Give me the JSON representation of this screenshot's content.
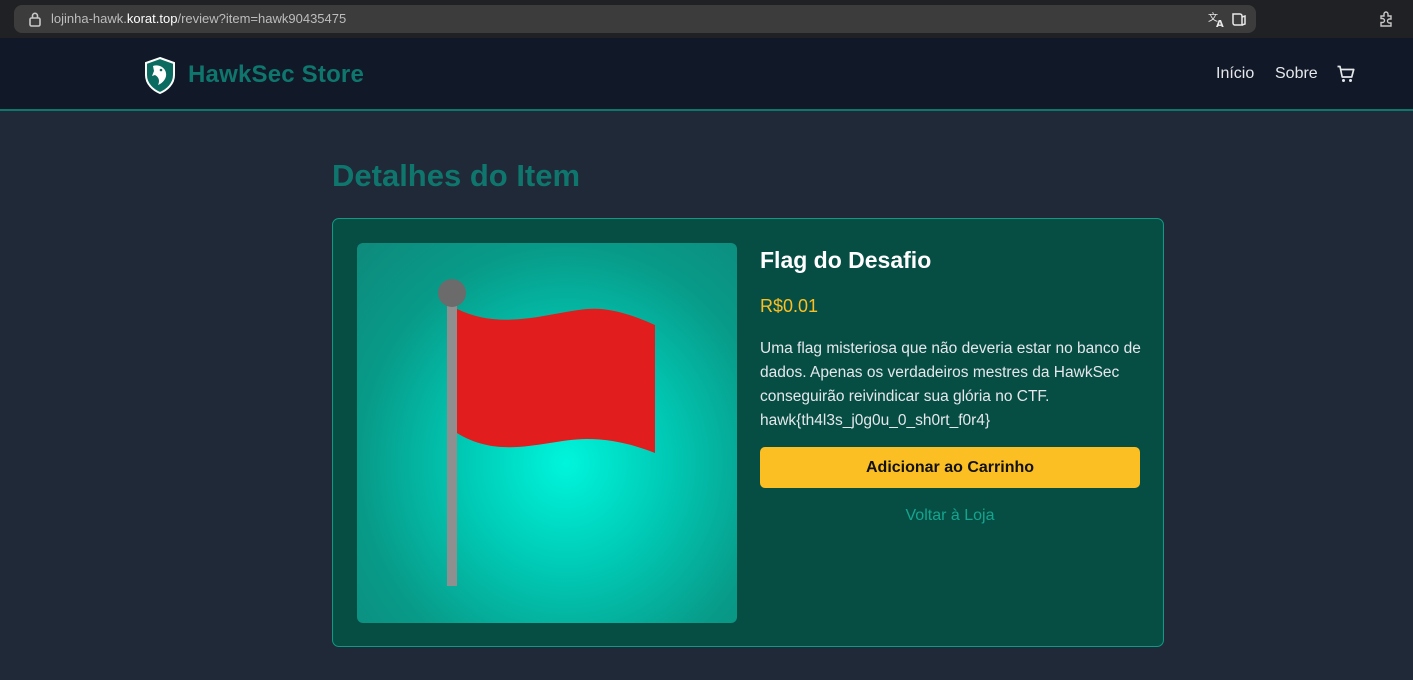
{
  "browser": {
    "url_prefix": "lojinha-hawk.",
    "url_host": "korat.top",
    "url_path": "/review?item=hawk90435475"
  },
  "header": {
    "brand": "HawkSec Store",
    "nav": {
      "home": "Início",
      "about": "Sobre"
    }
  },
  "page": {
    "title": "Detalhes do Item"
  },
  "item": {
    "name": "Flag do Desafio",
    "price": "R$0.01",
    "description": "Uma flag misteriosa que não deveria estar no banco de dados. Apenas os verdadeiros mestres da HawkSec conseguirão reivindicar sua glória no CTF. hawk{th4l3s_j0g0u_0_sh0rt_f0r4}",
    "add_to_cart_label": "Adicionar ao Carrinho",
    "back_label": "Voltar à Loja"
  },
  "colors": {
    "accent": "#0f766e",
    "price": "#fbbf24",
    "card_bg": "#064e44",
    "page_bg": "#1f2937"
  },
  "icons": [
    "lock-icon",
    "translate-icon",
    "reader-mode-icon",
    "extensions-icon",
    "hawk-logo-icon",
    "cart-icon",
    "flag-icon"
  ]
}
